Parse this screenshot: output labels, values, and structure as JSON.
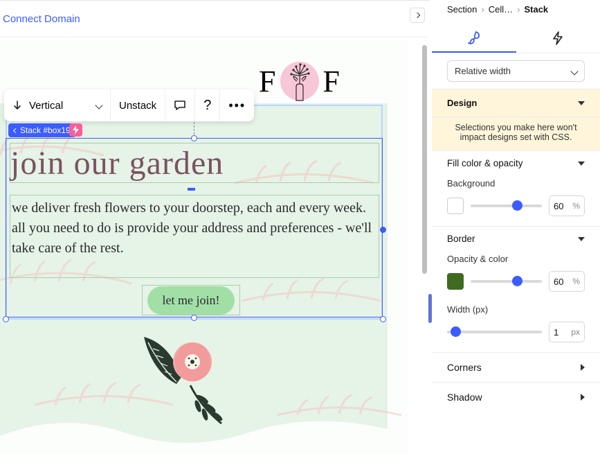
{
  "topbar": {
    "connect_domain": "Connect Domain"
  },
  "logo": {
    "left_letter": "F",
    "right_letter": "F"
  },
  "floating_toolbar": {
    "direction_label": "Vertical",
    "unstack_label": "Unstack"
  },
  "selection": {
    "pill_label": "Stack #box19"
  },
  "content": {
    "heading": "join our garden",
    "body_line1": "we deliver fresh flowers to your doorstep, each and every week.",
    "body_line2": "all you need to do is provide your address and preferences - we'll take care of the rest.",
    "cta": "let me join!"
  },
  "right_panel": {
    "breadcrumb": {
      "section": "Section",
      "cell": "Cell…",
      "current": "Stack"
    },
    "width_mode": "Relative width",
    "design_header": "Design",
    "css_warning": "Selections you make here won't impact designs set with CSS.",
    "fill": {
      "label": "Fill color & opacity",
      "background_label": "Background",
      "background_value": "60",
      "background_unit": "%",
      "bg_swatch_color": "#ffffff"
    },
    "border": {
      "label": "Border",
      "opacity_label": "Opacity & color",
      "opacity_value": "60",
      "opacity_unit": "%",
      "color_swatch": "#3e6b1f",
      "width_label": "Width (px)",
      "width_value": "1",
      "width_unit": "px"
    },
    "corners_label": "Corners",
    "shadow_label": "Shadow"
  }
}
